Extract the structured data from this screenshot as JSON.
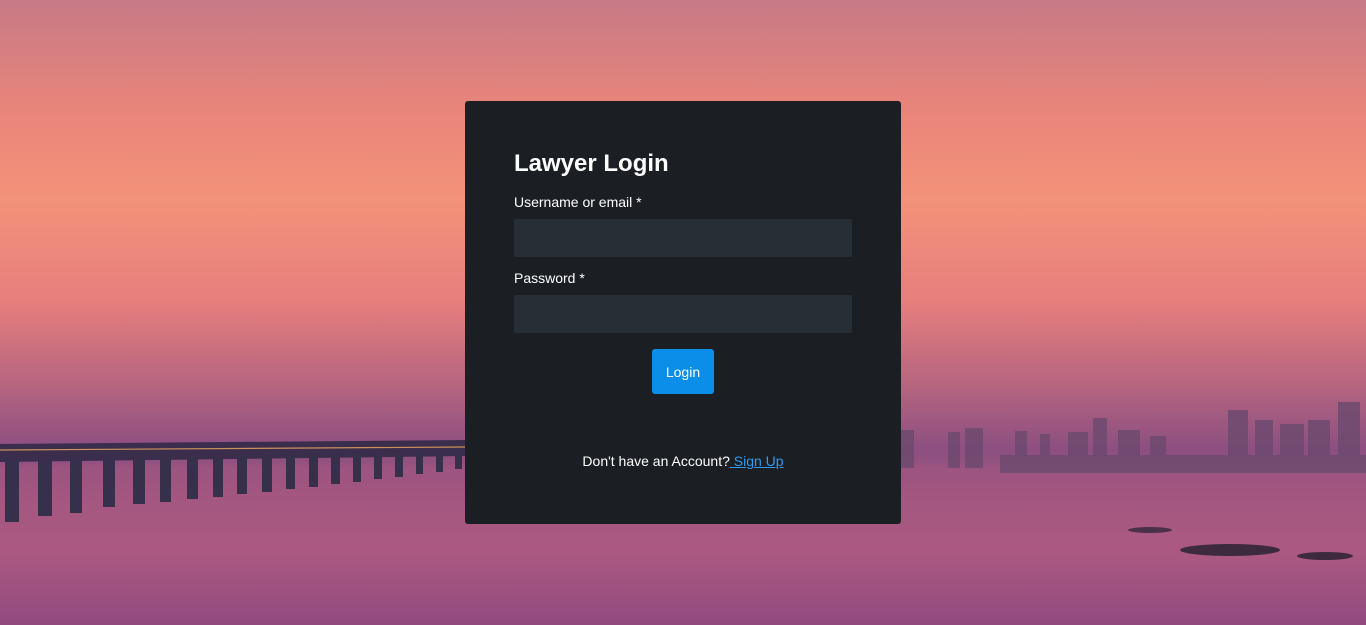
{
  "login": {
    "title": "Lawyer Login",
    "username_label": "Username or email *",
    "username_value": "",
    "password_label": "Password *",
    "password_value": "",
    "login_button": "Login",
    "signup_prompt": "Don't have an Account?",
    "signup_link": " Sign Up"
  },
  "colors": {
    "card_bg": "#1b1e23",
    "input_bg": "#282e35",
    "button_bg": "#0a8ee8",
    "link": "#2d9cf0"
  }
}
